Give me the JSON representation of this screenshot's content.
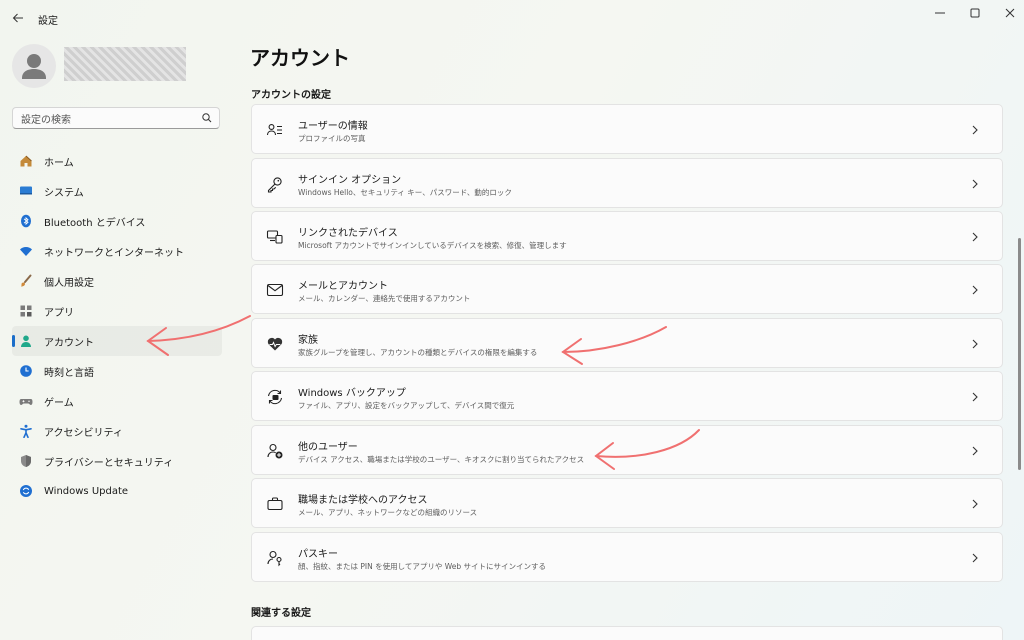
{
  "app": {
    "title": "設定"
  },
  "sidebar": {
    "search_placeholder": "設定の検索",
    "items": [
      {
        "label": "ホーム"
      },
      {
        "label": "システム"
      },
      {
        "label": "Bluetooth とデバイス"
      },
      {
        "label": "ネットワークとインターネット"
      },
      {
        "label": "個人用設定"
      },
      {
        "label": "アプリ"
      },
      {
        "label": "アカウント"
      },
      {
        "label": "時刻と言語"
      },
      {
        "label": "ゲーム"
      },
      {
        "label": "アクセシビリティ"
      },
      {
        "label": "プライバシーとセキュリティ"
      },
      {
        "label": "Windows Update"
      }
    ],
    "active": "アカウント"
  },
  "main": {
    "title": "アカウント",
    "section_settings": "アカウントの設定",
    "cards": [
      {
        "title": "ユーザーの情報",
        "sub": "プロファイルの写真"
      },
      {
        "title": "サインイン オプション",
        "sub": "Windows Hello、セキュリティ キー、パスワード、動的ロック"
      },
      {
        "title": "リンクされたデバイス",
        "sub": "Microsoft アカウントでサインインしているデバイスを検索、修復、管理します"
      },
      {
        "title": "メールとアカウント",
        "sub": "メール、カレンダー、連絡先で使用するアカウント"
      },
      {
        "title": "家族",
        "sub": "家族グループを管理し、アカウントの種類とデバイスの権限を編集する"
      },
      {
        "title": "Windows バックアップ",
        "sub": "ファイル、アプリ、設定をバックアップして、デバイス間で復元"
      },
      {
        "title": "他のユーザー",
        "sub": "デバイス アクセス、職場または学校のユーザー、キオスクに割り当てられたアクセス"
      },
      {
        "title": "職場または学校へのアクセス",
        "sub": "メール、アプリ、ネットワークなどの組織のリソース"
      },
      {
        "title": "パスキー",
        "sub": "顔、指紋、または PIN を使用してアプリや Web サイトにサインインする"
      }
    ],
    "section_related": "関連する設定"
  },
  "colors": {
    "accent": "#1a6dc9",
    "annotation_arrow": "#f07070"
  }
}
